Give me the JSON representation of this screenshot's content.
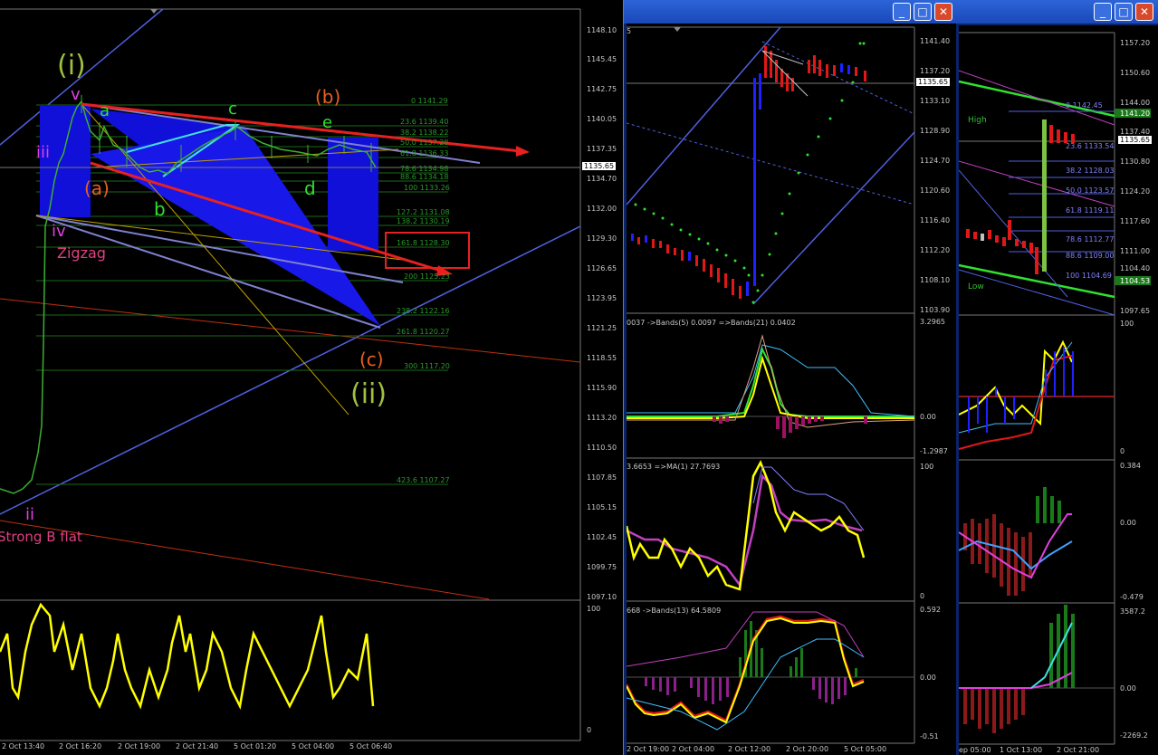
{
  "windows": {
    "main": {
      "price_ticks": [
        "1148.10",
        "1145.45",
        "1142.75",
        "1140.05",
        "1137.35",
        "1134.70",
        "1132.00",
        "1129.30",
        "1126.65",
        "1123.95",
        "1121.25",
        "1118.55",
        "1115.90",
        "1113.20",
        "1110.50",
        "1107.85",
        "1105.15",
        "1102.45",
        "1099.75",
        "1097.10"
      ],
      "current_price": "1135.65",
      "fib_levels": [
        "0 1141.29",
        "23.6 1139.40",
        "38.2 1138.22",
        "50.0 1137.28",
        "61.8 1136.33",
        "78.6 1134.98",
        "88.6 1134.18",
        "100 1133.26",
        "127.2 1131.08",
        "138.2 1130.19",
        "161.8 1128.30",
        "200 1125.23",
        "238.2 1122.16",
        "261.8 1120.27",
        "300 1117.20",
        "423.6 1107.27"
      ],
      "wave_labels": {
        "i": "(i)",
        "v": "v",
        "a": "a",
        "c": "c",
        "b_paren": "(b)",
        "e": "e",
        "iii": "iii",
        "a_paren": "(a)",
        "d": "d",
        "b": "b",
        "iv": "iv",
        "zigzag": "Zigzag",
        "c_paren": "(c)",
        "ii_paren": "(ii)",
        "ii": "ii",
        "strong": "Strong B flat"
      },
      "osc_ticks": [
        "100",
        "0"
      ],
      "time_ticks": [
        "2 Oct 13:40",
        "2 Oct 16:20",
        "2 Oct 19:00",
        "2 Oct 21:40",
        "5 Oct 01:20",
        "5 Oct 04:00",
        "5 Oct 06:40"
      ]
    },
    "middle": {
      "price_ticks": [
        "1141.40",
        "1137.20",
        "1133.10",
        "1128.90",
        "1124.70",
        "1120.60",
        "1116.40",
        "1112.20",
        "1108.10",
        "1103.90"
      ],
      "current_price": "1135.65",
      "top_label": "5",
      "sub1": {
        "title": "0037  ->Bands(5) 0.0097  =>Bands(21) 0.0402",
        "ticks": [
          "3.2965",
          "0.00",
          "-1.2987"
        ]
      },
      "sub2": {
        "title": "3.6653  =>MA(1) 27.7693",
        "ticks": [
          "100",
          "0"
        ]
      },
      "sub3": {
        "title": "668  ->Bands(13) 64.5809",
        "ticks": [
          "0.592",
          "0.00",
          "-0.51"
        ]
      },
      "time_ticks": [
        "2 Oct 19:00",
        "2 Oct 04:00",
        "2 Oct 12:00",
        "2 Oct 20:00",
        "5 Oct 05:00"
      ]
    },
    "right": {
      "price_ticks": [
        "1157.20",
        "1150.60",
        "1144.00",
        "1137.40",
        "1130.80",
        "1124.20",
        "1117.60",
        "1111.00",
        "1104.40",
        "1097.65"
      ],
      "current_price": "1135.65",
      "high_tag": "1141.20",
      "low_tag": "1104.53",
      "high_label": "High",
      "low_label": "Low",
      "fib_levels": [
        "0 1142.45",
        "23.6 1133.54",
        "38.2 1128.03",
        "50.0 1123.57",
        "61.8 1119.11",
        "78.6 1112.77",
        "88.6 1109.00",
        "100 1104.69"
      ],
      "sub1_ticks": [
        "100",
        "0"
      ],
      "sub2_ticks": [
        "0.384",
        "0.00",
        "-0.479"
      ],
      "sub3_ticks": [
        "3587.2",
        "0.00",
        "-2269.2"
      ],
      "time_ticks": [
        "ep 05:00",
        "1 Oct 13:00",
        "2 Oct 21:00"
      ]
    }
  },
  "buttons": {
    "minimize": "_",
    "maximize": "□",
    "close": "✕"
  },
  "colors": {
    "bull": "#2020ff",
    "bear": "#e01818",
    "fib": "#2a9a2a",
    "trend": "#5060e0",
    "yellow": "#ffff00"
  }
}
